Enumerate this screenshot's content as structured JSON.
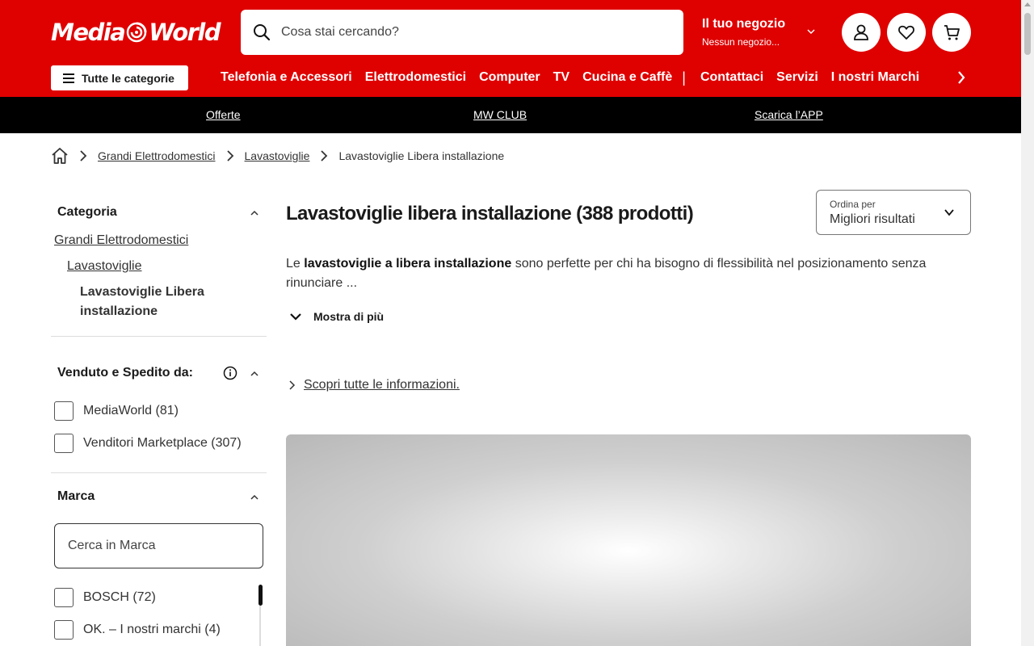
{
  "header": {
    "logo_text_1": "Media",
    "logo_text_2": "World",
    "search_placeholder": "Cosa stai cercando?",
    "store_title": "Il tuo negozio",
    "store_subtitle": "Nessun negozio...",
    "categories_button": "Tutte le categorie",
    "nav": [
      "Telefonia e Accessori",
      "Elettrodomestici",
      "Computer",
      "TV",
      "Cucina e Caffè",
      "Contattaci",
      "Servizi",
      "I nostri Marchi"
    ],
    "nav_separator": "|"
  },
  "promo_bar": {
    "links": [
      "Offerte",
      "MW CLUB",
      "Scarica l’APP"
    ]
  },
  "breadcrumb": {
    "items": [
      "Grandi Elettrodomestici",
      "Lavastoviglie"
    ],
    "current": "Lavastoviglie Libera installazione"
  },
  "sidebar": {
    "category": {
      "title": "Categoria",
      "level1": "Grandi Elettrodomestici",
      "level2": "Lavastoviglie",
      "level3": "Lavastoviglie Libera installazione"
    },
    "seller": {
      "title": "Venduto e Spedito da:",
      "options": [
        "MediaWorld (81)",
        "Venditori Marketplace (307)"
      ]
    },
    "brand": {
      "title": "Marca",
      "search_placeholder": "Cerca in Marca",
      "options": [
        "BOSCH (72)",
        "OK. – I nostri marchi (4)"
      ]
    }
  },
  "main": {
    "title": "Lavastoviglie libera installazione",
    "count": "(388 prodotti)",
    "sort_label": "Ordina per",
    "sort_value": "Migliori risultati",
    "desc_pre": "Le ",
    "desc_bold": "lavastoviglie a libera installazione",
    "desc_post": " sono perfette per chi ha bisogno di flessibilità nel posizionamento senza rinunciare ...",
    "show_more": "Mostra di più",
    "info_link": "Scopri tutte le informazioni."
  },
  "colors": {
    "brand_red": "#df0000",
    "promo_black": "#000000"
  }
}
